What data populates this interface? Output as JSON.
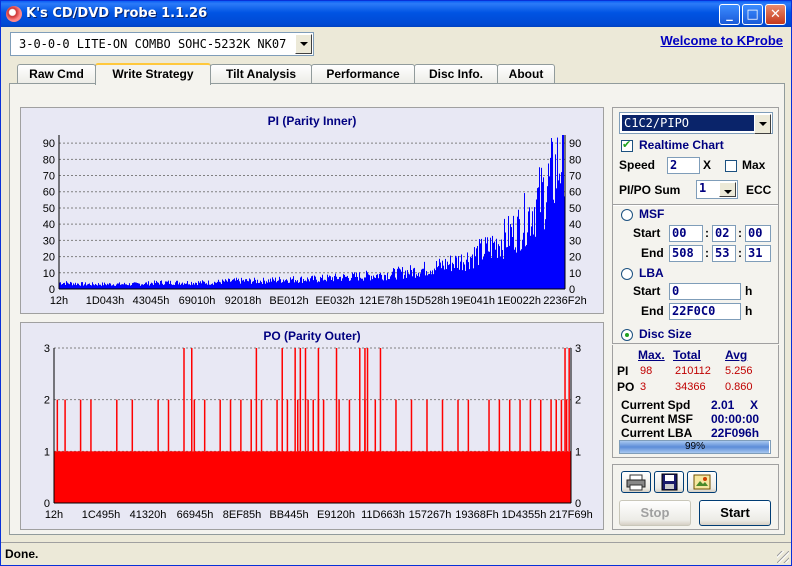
{
  "window": {
    "title": "K's CD/DVD Probe 1.1.26",
    "minimize": "_",
    "maximize": "□",
    "close": "✕"
  },
  "drive": {
    "value": "3-0-0-0 LITE-ON COMBO SOHC-5232K NK07"
  },
  "welcome_link": "Welcome to KProbe",
  "tabs": [
    {
      "label": "Raw Cmd"
    },
    {
      "label": "Write Strategy"
    },
    {
      "label": "Tilt Analysis"
    },
    {
      "label": "Performance"
    },
    {
      "label": "Disc Info."
    },
    {
      "label": "About"
    }
  ],
  "active_tab": "Write Strategy",
  "chart_data": [
    {
      "type": "bar",
      "title": "PI (Parity Inner)",
      "xlabel": "",
      "ylabel": "",
      "ylim": [
        0,
        95
      ],
      "yticks": [
        0,
        10,
        20,
        30,
        40,
        50,
        60,
        70,
        80,
        90
      ],
      "xticks": [
        "12h",
        "1D043h",
        "43045h",
        "69010h",
        "92018h",
        "BE012h",
        "EE032h",
        "121E78h",
        "15D528h",
        "19E041h",
        "1E0022h",
        "2236F2h"
      ],
      "grid": true,
      "color": "#0000FF",
      "x": [
        0,
        0.05,
        0.1,
        0.15,
        0.2,
        0.25,
        0.3,
        0.35,
        0.4,
        0.45,
        0.5,
        0.55,
        0.6,
        0.65,
        0.7,
        0.75,
        0.8,
        0.85,
        0.88,
        0.91,
        0.93,
        0.95,
        0.97,
        0.99,
        1.0
      ],
      "values": [
        4,
        3,
        3,
        3,
        4,
        4,
        4,
        5,
        5,
        6,
        6,
        7,
        8,
        9,
        11,
        14,
        18,
        25,
        31,
        38,
        46,
        55,
        65,
        78,
        95
      ]
    },
    {
      "type": "bar",
      "title": "PO (Parity Outer)",
      "xlabel": "",
      "ylabel": "",
      "ylim": [
        0,
        3
      ],
      "yticks": [
        0,
        1,
        2,
        3
      ],
      "xticks": [
        "12h",
        "1C495h",
        "41320h",
        "66945h",
        "8EF85h",
        "BB445h",
        "E9120h",
        "11D663h",
        "157267h",
        "19368Fh",
        "1D4355h",
        "217F69h"
      ],
      "grid": true,
      "color": "#FF0000",
      "baseline": 1,
      "x_twos": [
        0.005,
        0.02,
        0.05,
        0.07,
        0.12,
        0.15,
        0.2,
        0.22,
        0.27,
        0.29,
        0.32,
        0.34,
        0.36,
        0.38,
        0.4,
        0.43,
        0.45,
        0.47,
        0.49,
        0.5,
        0.51,
        0.52,
        0.55,
        0.57,
        0.6,
        0.62,
        0.66,
        0.69,
        0.72,
        0.75,
        0.78,
        0.8,
        0.84,
        0.86,
        0.88,
        0.9,
        0.92,
        0.94,
        0.96,
        0.97,
        0.98,
        0.99
      ],
      "x_threes": [
        0.25,
        0.265,
        0.39,
        0.44,
        0.465,
        0.475,
        0.485,
        0.51,
        0.545,
        0.59,
        0.6,
        0.605,
        0.63,
        0.987,
        0.995
      ]
    }
  ],
  "right": {
    "mode": "C1C2/PIPO",
    "realtime_chart": "Realtime Chart",
    "realtime_checked": true,
    "speed_label": "Speed",
    "speed_value": "2",
    "speed_unit": "X",
    "max_label": "Max",
    "max_checked": false,
    "pipo_sum_label": "PI/PO Sum",
    "pipo_sum_value": "1",
    "ecc_label": "ECC",
    "msf_label": "MSF",
    "start_label": "Start",
    "end_label": "End",
    "msf_start": [
      "00",
      "02",
      "00"
    ],
    "msf_end": [
      "508",
      "53",
      "31"
    ],
    "msf_sep": ":",
    "lba_label": "LBA",
    "lba_start": "0",
    "lba_end": "22F0C0",
    "lba_unit": "h",
    "disc_size_label": "Disc Size",
    "selected_range": "Disc Size"
  },
  "stats": {
    "hdr_max": "Max.",
    "hdr_total": "Total",
    "hdr_avg": "Avg",
    "pi_label": "PI",
    "pi_max": "98",
    "pi_total": "210112",
    "pi_avg": "5.256",
    "po_label": "PO",
    "po_max": "3",
    "po_total": "34366",
    "po_avg": "0.860",
    "spd_label": "Current Spd",
    "spd_value": "2.01",
    "spd_unit": "X",
    "msf_label": "Current MSF",
    "msf_value": "00:00:00",
    "lba_label": "Current LBA",
    "lba_value": "22F096h",
    "progress_text": "99%",
    "progress": 0.99
  },
  "buttons": {
    "stop": "Stop",
    "start": "Start"
  },
  "status": "Done.",
  "colors": {
    "titlebar": "#0054E3",
    "pi": "#0000FF",
    "po": "#FF0000",
    "label_blue": "#000080"
  }
}
